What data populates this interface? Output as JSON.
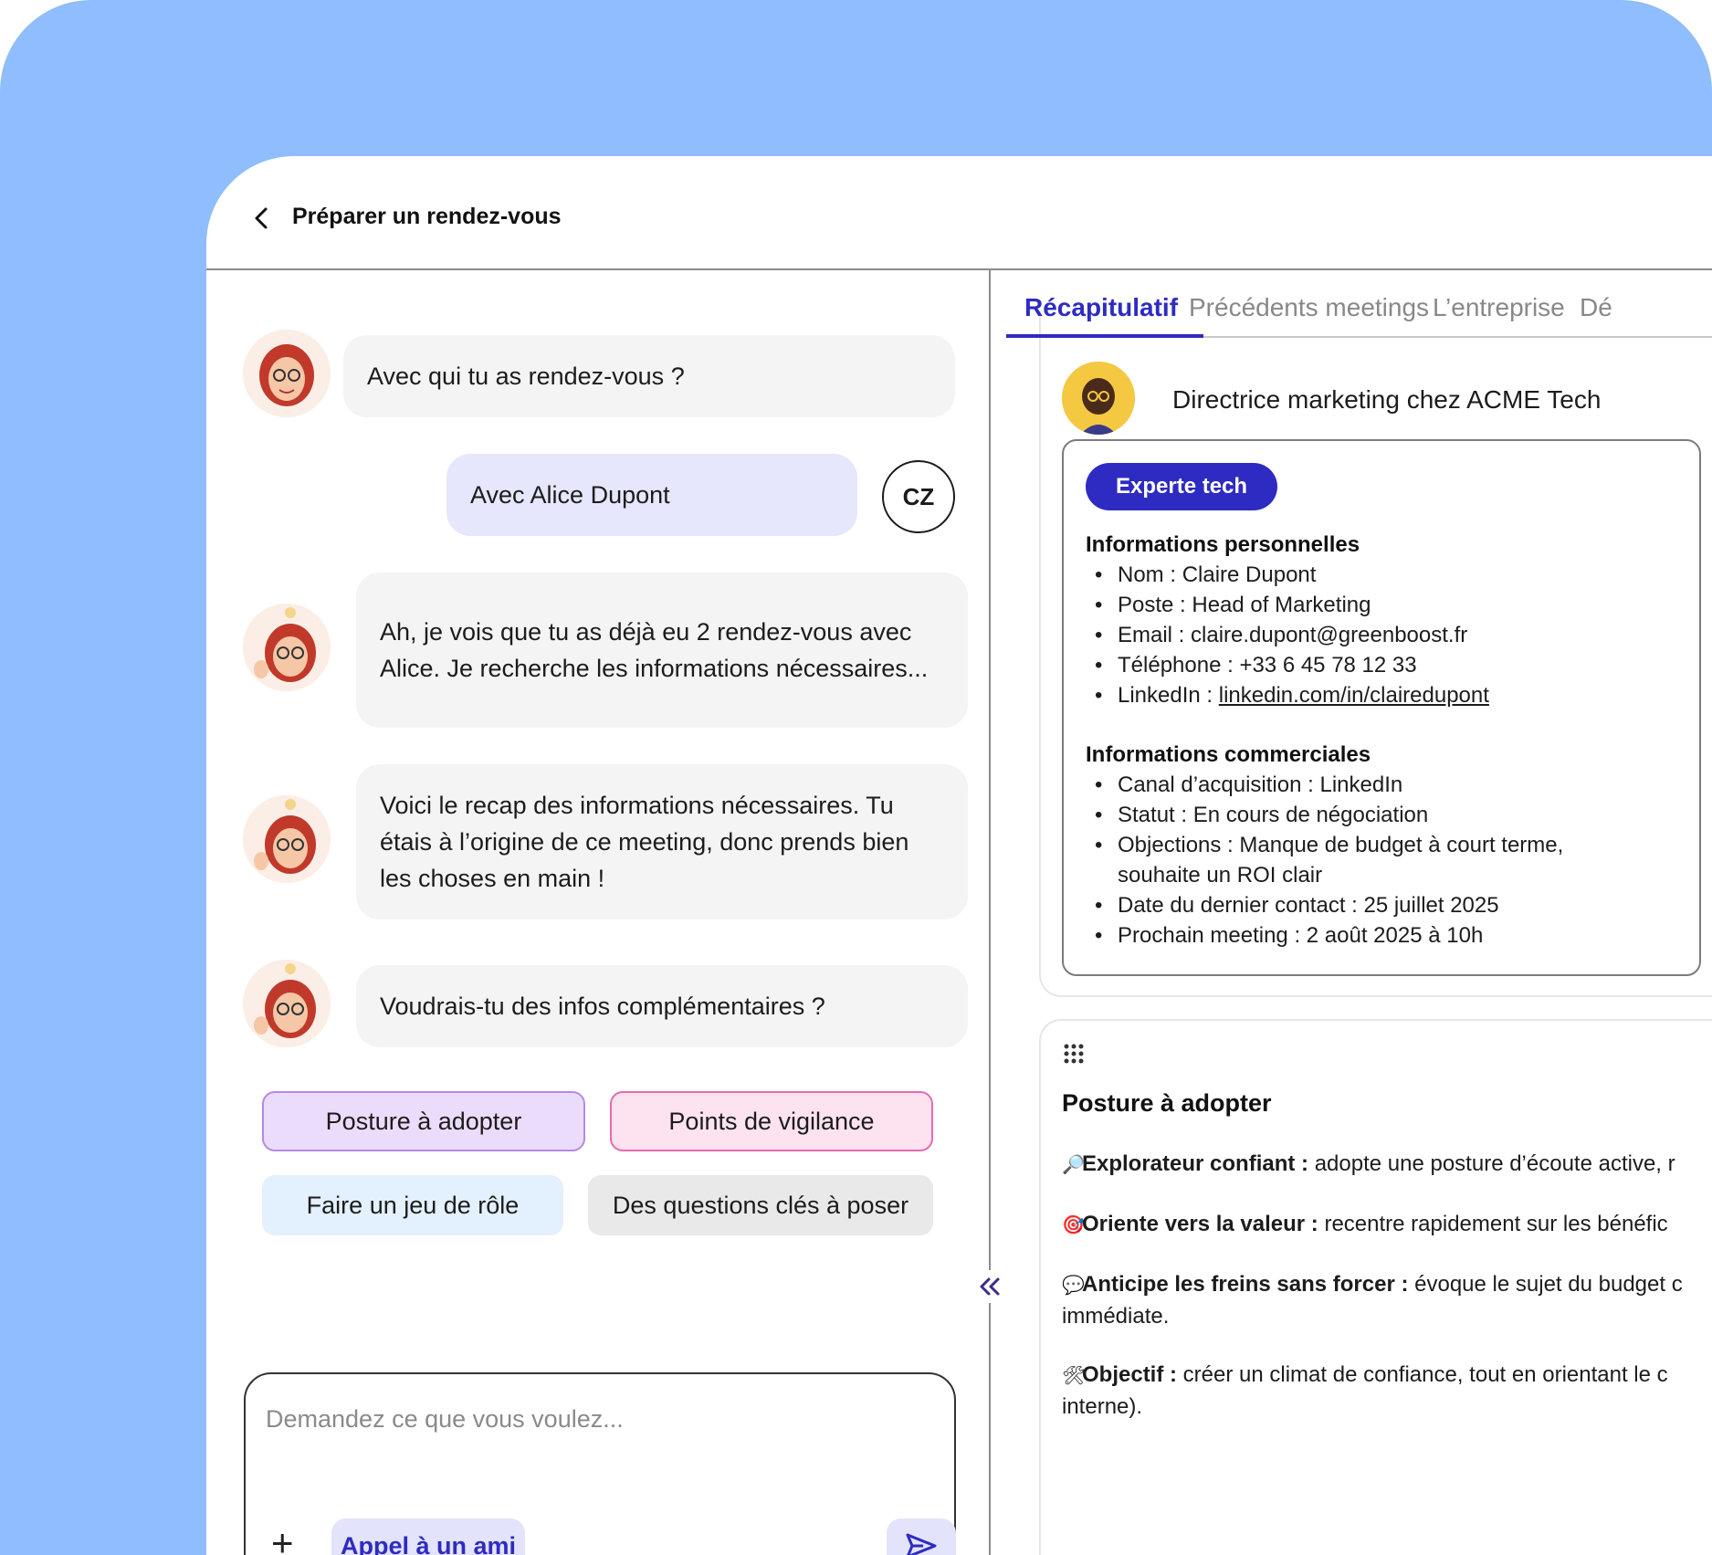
{
  "header": {
    "title": "Préparer un rendez-vous"
  },
  "chat": {
    "messages": [
      {
        "role": "bot",
        "text": "Avec qui tu as rendez-vous ?"
      },
      {
        "role": "user",
        "text": "Avec Alice Dupont",
        "initials": "CZ"
      },
      {
        "role": "bot",
        "text": "Ah, je vois que tu as déjà eu 2 rendez-vous avec Alice. Je recherche les informations nécessaires..."
      },
      {
        "role": "bot",
        "text": "Voici le recap des informations nécessaires. Tu étais à l’origine de ce meeting, donc prends bien les choses en main !"
      },
      {
        "role": "bot",
        "text": "Voudrais-tu des infos complémentaires ?"
      }
    ],
    "suggestions": [
      "Posture à adopter",
      "Points de vigilance",
      "Faire un jeu de rôle",
      "Des questions clés à poser"
    ],
    "input": {
      "placeholder": "Demandez ce que vous voulez...",
      "friend_button": "Appel à un ami"
    }
  },
  "panel": {
    "tabs": [
      "Récapitulatif",
      "Précédents meetings",
      "L’entreprise",
      "Dé"
    ],
    "active_tab": "Récapitulatif",
    "profile": {
      "role": "Directrice marketing chez ACME Tech",
      "badge": "Experte tech"
    },
    "personal": {
      "title": "Informations personnelles",
      "items": [
        {
          "label": "Nom : ",
          "value": "Claire Dupont"
        },
        {
          "label": "Poste : ",
          "value": "Head of Marketing"
        },
        {
          "label": "Email : ",
          "value": "claire.dupont@greenboost.fr"
        },
        {
          "label": "Téléphone : ",
          "value": "+33 6 45 78 12 33"
        },
        {
          "label": "LinkedIn : ",
          "value": "linkedin.com/in/clairedupont"
        }
      ]
    },
    "commercial": {
      "title": "Informations commerciales",
      "items": [
        {
          "label": "Canal d’acquisition : ",
          "value": "LinkedIn"
        },
        {
          "label": "Statut : ",
          "value": "En cours de négociation"
        },
        {
          "label": "Objections : ",
          "value": "Manque de budget à court terme, souhaite un ROI clair"
        },
        {
          "label": "Date du dernier contact : ",
          "value": "25 juillet 2025"
        },
        {
          "label": "Prochain meeting : ",
          "value": "2 août 2025 à 10h"
        }
      ]
    },
    "posture": {
      "title": "Posture à adopter",
      "items": [
        {
          "icon": "🔎",
          "label": "Explorateur confiant :",
          "text": " adopte une posture d’écoute active, r"
        },
        {
          "icon": "🎯",
          "label": "Oriente vers la valeur :",
          "text": " recentre rapidement sur les bénéfic"
        },
        {
          "icon": "💬",
          "label": "Anticipe les freins sans forcer :",
          "text": " évoque le sujet du budget c",
          "line2": "immédiate."
        },
        {
          "icon": "🛠",
          "label": "Objectif :",
          "text": " créer un climat de confiance, tout en orientant le c",
          "line2": "interne)."
        }
      ]
    }
  },
  "colors": {
    "accent": "#2e2bc2",
    "background": "#8fbdfd"
  }
}
